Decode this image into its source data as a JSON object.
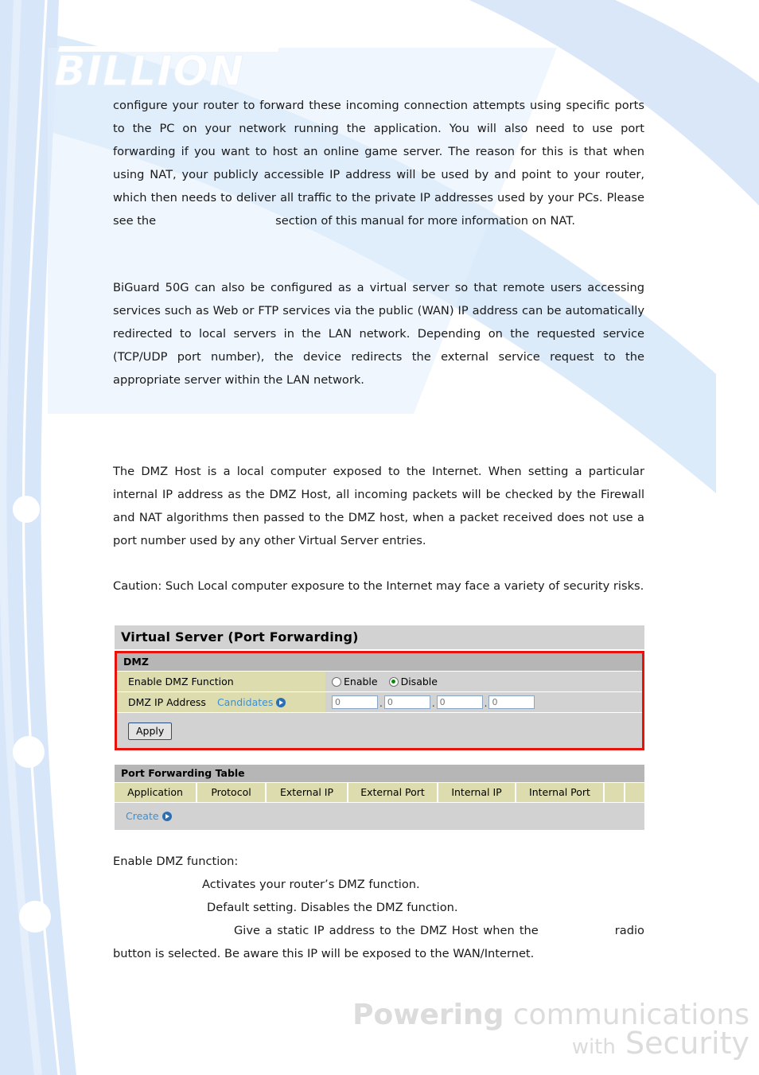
{
  "branding": {
    "logo_text": "BILLION",
    "footer_line1_bold": "Powering",
    "footer_line1_light": "communications",
    "footer_line2_light": "with",
    "footer_line2_bold": "Security"
  },
  "body": {
    "para_intro": "configure your router to forward these incoming connection attempts using specific ports to the PC on your network running the application. You will also need to use port forwarding if you want to host an online game server. The reason for this is that when using NAT, your publicly accessible IP address will be used by and point to your router, which then needs to deliver all traffic to the private IP addresses used by your PCs. Please see the",
    "para_intro_cont": "section of this manual for more information on NAT.",
    "para_biguard": "BiGuard 50G can also be configured as a virtual server so that remote users accessing services such as Web or FTP services via the public (WAN) IP address can be automatically redirected to local servers in the LAN network. Depending on the requested service (TCP/UDP port number), the device redirects the external service request to the appropriate server within the LAN network.",
    "para_dmz": "The DMZ Host is a local computer exposed to the Internet. When setting a particular internal IP address as the DMZ Host, all incoming packets will be checked by the Firewall and NAT algorithms then passed to the DMZ host, when a packet received does not use a port number used by any other Virtual Server entries.",
    "para_caution": "Caution: Such Local computer exposure to the Internet may face a variety of security risks."
  },
  "descriptions": {
    "heading": "Enable DMZ function:",
    "line_enable": "Activates your router’s DMZ function.",
    "line_disable": "Default setting. Disables the DMZ function.",
    "line_ip_part1": "Give a static IP address to the DMZ Host when the",
    "line_ip_part2": "radio button is selected. Be aware this IP will be exposed to the WAN/Internet."
  },
  "ui": {
    "title": "Virtual Server (Port Forwarding)",
    "dmz": {
      "section_title": "DMZ",
      "enable_label": "Enable DMZ Function",
      "radio_enable": "Enable",
      "radio_disable": "Disable",
      "selected": "Disable",
      "ip_label": "DMZ IP Address",
      "candidates_link": "Candidates",
      "ip_octets": [
        "0",
        "0",
        "0",
        "0"
      ],
      "ip_separator": ".",
      "apply_label": "Apply"
    },
    "forwarding": {
      "section_title": "Port Forwarding Table",
      "columns": [
        "Application",
        "Protocol",
        "External IP",
        "External Port",
        "Internal IP",
        "Internal Port",
        "",
        ""
      ],
      "rows": [],
      "create_link": "Create"
    }
  },
  "colors": {
    "accent_blue": "#3f8fd0",
    "annotation_red": "#e8120c",
    "label_khaki": "#dcdcae",
    "panel_gray": "#d2d2d2",
    "section_gray": "#b6b6b6",
    "radio_selected_green": "#0a8a0a",
    "decor_blue": "#d4e4f7"
  }
}
